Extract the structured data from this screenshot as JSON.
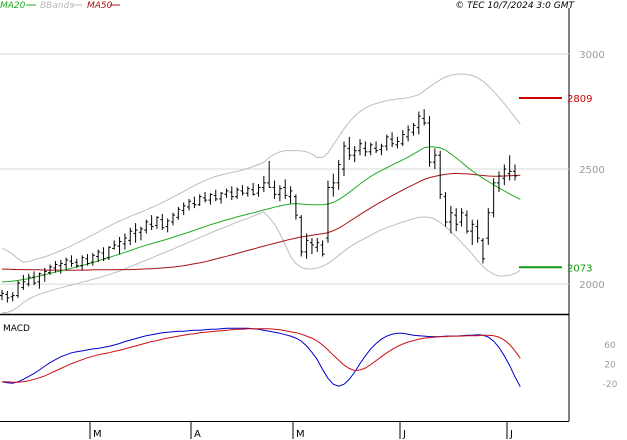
{
  "chart_data": [
    {
      "type": "ohlc",
      "legend": {
        "items": [
          {
            "label": "MA20",
            "color": "#22aa22"
          },
          {
            "label": "BBands",
            "color": "#b8b8b8"
          },
          {
            "label": "MA50",
            "color": "#aa1111"
          }
        ],
        "placement": "top-left"
      },
      "stamp": "© TEC 10/7/2024 3:0 GMT",
      "y_ticks": [
        "3000",
        "2500",
        "2000"
      ],
      "ylim": [
        1870,
        3200
      ],
      "x_ticks": [
        "M",
        "A",
        "M",
        "J",
        "J"
      ],
      "levels": [
        {
          "label": "2809",
          "value": 2809,
          "color": "#cc0000"
        },
        {
          "label": "2073",
          "value": 2073,
          "color": "#119911"
        }
      ],
      "price_ohlc": [
        [
          1950,
          1975,
          1930,
          1960
        ],
        [
          1955,
          1970,
          1920,
          1940
        ],
        [
          1945,
          1965,
          1925,
          1950
        ],
        [
          1950,
          2015,
          1940,
          2005
        ],
        [
          1985,
          2040,
          1975,
          2010
        ],
        [
          2000,
          2045,
          1990,
          2030
        ],
        [
          2030,
          2055,
          1995,
          2005
        ],
        [
          2010,
          2050,
          1980,
          2045
        ],
        [
          2040,
          2070,
          2010,
          2055
        ],
        [
          2050,
          2085,
          2040,
          2075
        ],
        [
          2070,
          2100,
          2050,
          2085
        ],
        [
          2080,
          2105,
          2045,
          2090
        ],
        [
          2085,
          2115,
          2060,
          2105
        ],
        [
          2100,
          2125,
          2075,
          2090
        ],
        [
          2095,
          2110,
          2070,
          2080
        ],
        [
          2080,
          2125,
          2060,
          2115
        ],
        [
          2110,
          2130,
          2080,
          2090
        ],
        [
          2095,
          2135,
          2080,
          2125
        ],
        [
          2120,
          2150,
          2095,
          2140
        ],
        [
          2135,
          2160,
          2100,
          2110
        ],
        [
          2115,
          2165,
          2105,
          2160
        ],
        [
          2155,
          2190,
          2150,
          2170
        ],
        [
          2165,
          2205,
          2130,
          2185
        ],
        [
          2175,
          2220,
          2150,
          2200
        ],
        [
          2190,
          2245,
          2170,
          2230
        ],
        [
          2220,
          2265,
          2180,
          2235
        ],
        [
          2225,
          2250,
          2190,
          2240
        ],
        [
          2235,
          2280,
          2220,
          2270
        ],
        [
          2260,
          2300,
          2235,
          2250
        ],
        [
          2255,
          2295,
          2240,
          2290
        ],
        [
          2280,
          2305,
          2235,
          2245
        ],
        [
          2250,
          2285,
          2225,
          2275
        ],
        [
          2270,
          2310,
          2255,
          2300
        ],
        [
          2290,
          2335,
          2280,
          2325
        ],
        [
          2320,
          2355,
          2300,
          2340
        ],
        [
          2335,
          2370,
          2320,
          2360
        ],
        [
          2350,
          2380,
          2330,
          2345
        ],
        [
          2345,
          2390,
          2340,
          2380
        ],
        [
          2375,
          2400,
          2355,
          2365
        ],
        [
          2365,
          2395,
          2345,
          2390
        ],
        [
          2385,
          2410,
          2360,
          2370
        ],
        [
          2370,
          2400,
          2350,
          2395
        ],
        [
          2390,
          2415,
          2375,
          2405
        ],
        [
          2400,
          2425,
          2365,
          2380
        ],
        [
          2380,
          2420,
          2370,
          2410
        ],
        [
          2405,
          2430,
          2385,
          2395
        ],
        [
          2395,
          2425,
          2380,
          2415
        ],
        [
          2410,
          2440,
          2385,
          2390
        ],
        [
          2395,
          2435,
          2380,
          2420
        ],
        [
          2420,
          2470,
          2400,
          2440
        ],
        [
          2440,
          2535,
          2420,
          2420
        ],
        [
          2420,
          2450,
          2370,
          2390
        ],
        [
          2390,
          2430,
          2360,
          2415
        ],
        [
          2420,
          2455,
          2370,
          2385
        ],
        [
          2380,
          2425,
          2350,
          2405
        ],
        [
          2380,
          2390,
          2280,
          2300
        ],
        [
          2290,
          2300,
          2120,
          2140
        ],
        [
          2140,
          2220,
          2110,
          2190
        ],
        [
          2180,
          2200,
          2130,
          2170
        ],
        [
          2160,
          2200,
          2140,
          2180
        ],
        [
          2170,
          2190,
          2120,
          2130
        ],
        [
          2200,
          2450,
          2180,
          2420
        ],
        [
          2420,
          2480,
          2380,
          2440
        ],
        [
          2440,
          2540,
          2410,
          2520
        ],
        [
          2500,
          2620,
          2470,
          2600
        ],
        [
          2590,
          2640,
          2540,
          2560
        ],
        [
          2560,
          2600,
          2530,
          2580
        ],
        [
          2580,
          2630,
          2560,
          2610
        ],
        [
          2590,
          2620,
          2555,
          2575
        ],
        [
          2575,
          2615,
          2560,
          2605
        ],
        [
          2590,
          2620,
          2570,
          2580
        ],
        [
          2585,
          2610,
          2560,
          2600
        ],
        [
          2600,
          2650,
          2580,
          2640
        ],
        [
          2630,
          2660,
          2595,
          2610
        ],
        [
          2605,
          2640,
          2590,
          2620
        ],
        [
          2610,
          2670,
          2600,
          2650
        ],
        [
          2640,
          2690,
          2620,
          2670
        ],
        [
          2660,
          2700,
          2645,
          2690
        ],
        [
          2680,
          2750,
          2650,
          2730
        ],
        [
          2720,
          2760,
          2690,
          2700
        ],
        [
          2700,
          2730,
          2510,
          2530
        ],
        [
          2530,
          2590,
          2500,
          2560
        ],
        [
          2560,
          2580,
          2370,
          2390
        ],
        [
          2380,
          2400,
          2250,
          2270
        ],
        [
          2270,
          2340,
          2220,
          2310
        ],
        [
          2300,
          2330,
          2230,
          2260
        ],
        [
          2270,
          2330,
          2250,
          2310
        ],
        [
          2300,
          2320,
          2220,
          2230
        ],
        [
          2230,
          2280,
          2170,
          2260
        ],
        [
          2250,
          2280,
          2180,
          2200
        ],
        [
          2190,
          2200,
          2090,
          2110
        ],
        [
          2200,
          2330,
          2170,
          2310
        ],
        [
          2310,
          2460,
          2290,
          2440
        ],
        [
          2440,
          2490,
          2400,
          2470
        ],
        [
          2460,
          2520,
          2430,
          2500
        ],
        [
          2480,
          2560,
          2450,
          2490
        ],
        [
          2490,
          2520,
          2450,
          2470
        ]
      ],
      "ma20": [
        2010,
        2011,
        2013,
        2016,
        2020,
        2024,
        2029,
        2035,
        2041,
        2047,
        2052,
        2058,
        2063,
        2069,
        2075,
        2081,
        2087,
        2094,
        2101,
        2108,
        2115,
        2123,
        2130,
        2138,
        2146,
        2154,
        2162,
        2169,
        2176,
        2183,
        2189,
        2196,
        2203,
        2211,
        2218,
        2226,
        2234,
        2242,
        2250,
        2258,
        2265,
        2272,
        2279,
        2285,
        2292,
        2298,
        2304,
        2310,
        2316,
        2322,
        2328,
        2334,
        2340,
        2344,
        2348,
        2350,
        2348,
        2346,
        2345,
        2345,
        2345,
        2348,
        2355,
        2367,
        2382,
        2399,
        2417,
        2435,
        2452,
        2468,
        2482,
        2494,
        2506,
        2518,
        2529,
        2540,
        2552,
        2565,
        2579,
        2593,
        2597,
        2596,
        2592,
        2582,
        2566,
        2548,
        2530,
        2510,
        2492,
        2476,
        2460,
        2446,
        2432,
        2418,
        2405,
        2392,
        2380,
        2368
      ],
      "bb_upper": [
        2155,
        2145,
        2130,
        2110,
        2095,
        2098,
        2105,
        2112,
        2118,
        2127,
        2136,
        2146,
        2156,
        2167,
        2179,
        2190,
        2202,
        2214,
        2226,
        2239,
        2251,
        2263,
        2274,
        2284,
        2294,
        2304,
        2313,
        2323,
        2333,
        2343,
        2354,
        2366,
        2378,
        2390,
        2403,
        2416,
        2428,
        2440,
        2450,
        2460,
        2468,
        2474,
        2480,
        2485,
        2490,
        2496,
        2503,
        2511,
        2520,
        2530,
        2550,
        2565,
        2575,
        2580,
        2580,
        2580,
        2579,
        2575,
        2565,
        2550,
        2550,
        2570,
        2605,
        2640,
        2675,
        2705,
        2730,
        2750,
        2765,
        2777,
        2785,
        2791,
        2797,
        2802,
        2805,
        2807,
        2810,
        2816,
        2823,
        2840,
        2857,
        2873,
        2888,
        2900,
        2908,
        2912,
        2913,
        2911,
        2906,
        2897,
        2882,
        2861,
        2838,
        2812,
        2784,
        2755,
        2725,
        2695
      ],
      "bb_lower": [
        1875,
        1877,
        1885,
        1900,
        1920,
        1935,
        1947,
        1956,
        1964,
        1971,
        1978,
        1984,
        1990,
        1996,
        2002,
        2008,
        2014,
        2021,
        2027,
        2034,
        2041,
        2049,
        2057,
        2066,
        2075,
        2085,
        2095,
        2104,
        2114,
        2124,
        2133,
        2143,
        2152,
        2162,
        2172,
        2182,
        2192,
        2202,
        2212,
        2222,
        2232,
        2241,
        2250,
        2260,
        2270,
        2278,
        2286,
        2295,
        2305,
        2313,
        2290,
        2260,
        2220,
        2170,
        2120,
        2090,
        2072,
        2066,
        2066,
        2070,
        2078,
        2090,
        2106,
        2125,
        2143,
        2160,
        2175,
        2188,
        2200,
        2212,
        2225,
        2236,
        2245,
        2254,
        2262,
        2270,
        2277,
        2284,
        2290,
        2292,
        2290,
        2282,
        2268,
        2250,
        2229,
        2205,
        2180,
        2156,
        2130,
        2102,
        2077,
        2057,
        2043,
        2035,
        2035,
        2038,
        2046,
        2060
      ],
      "ma50": [
        2065,
        2065,
        2064,
        2063,
        2063,
        2062,
        2062,
        2062,
        2061,
        2061,
        2061,
        2060,
        2060,
        2060,
        2061,
        2061,
        2061,
        2062,
        2062,
        2062,
        2062,
        2062,
        2063,
        2063,
        2063,
        2064,
        2065,
        2066,
        2067,
        2068,
        2070,
        2072,
        2074,
        2077,
        2080,
        2084,
        2088,
        2092,
        2097,
        2103,
        2109,
        2115,
        2121,
        2127,
        2133,
        2140,
        2146,
        2152,
        2159,
        2165,
        2171,
        2177,
        2183,
        2189,
        2195,
        2200,
        2205,
        2208,
        2212,
        2216,
        2219,
        2224,
        2232,
        2243,
        2257,
        2272,
        2287,
        2302,
        2317,
        2331,
        2345,
        2358,
        2371,
        2384,
        2397,
        2409,
        2421,
        2432,
        2444,
        2455,
        2463,
        2468,
        2473,
        2477,
        2480,
        2481,
        2480,
        2479,
        2477,
        2474,
        2472,
        2470,
        2469,
        2469,
        2470,
        2471,
        2472,
        2473
      ]
    },
    {
      "type": "line",
      "title": "MACD",
      "y_ticks": [
        "60",
        "20",
        "-20"
      ],
      "ylim": [
        -95,
        115
      ],
      "series": [
        {
          "name": "",
          "color": "#0000cc",
          "values": [
            -15,
            -17,
            -18,
            -15,
            -10,
            -4,
            2,
            9,
            17,
            24,
            30,
            36,
            40,
            44,
            46,
            48,
            50,
            52,
            53,
            55,
            57,
            60,
            63,
            67,
            70,
            73,
            76,
            79,
            81,
            83,
            85,
            86,
            87,
            88,
            88,
            89,
            90,
            90,
            91,
            92,
            92,
            93,
            94,
            94,
            94,
            94,
            94,
            93,
            92,
            90,
            88,
            86,
            84,
            81,
            78,
            74,
            68,
            58,
            45,
            30,
            10,
            -8,
            -20,
            -24,
            -20,
            -10,
            5,
            22,
            38,
            52,
            63,
            72,
            78,
            82,
            84,
            84,
            82,
            80,
            79,
            78,
            77,
            77,
            77,
            78,
            78,
            78,
            79,
            80,
            80,
            81,
            80,
            76,
            68,
            55,
            38,
            18,
            -5,
            -25
          ]
        },
        {
          "name": "",
          "color": "#cc1111",
          "values": [
            -15,
            -15,
            -16,
            -16,
            -15,
            -13,
            -10,
            -7,
            -3,
            2,
            7,
            12,
            17,
            22,
            26,
            30,
            34,
            37,
            40,
            42,
            44,
            47,
            49,
            52,
            55,
            58,
            61,
            64,
            67,
            69,
            72,
            74,
            76,
            78,
            80,
            82,
            83,
            85,
            86,
            87,
            88,
            89,
            90,
            91,
            92,
            92,
            93,
            93,
            93,
            93,
            93,
            92,
            91,
            89,
            87,
            85,
            82,
            78,
            74,
            68,
            60,
            50,
            39,
            29,
            19,
            12,
            8,
            9,
            13,
            20,
            28,
            36,
            44,
            51,
            57,
            62,
            66,
            69,
            72,
            74,
            75,
            76,
            77,
            77,
            78,
            78,
            78,
            79,
            79,
            79,
            80,
            80,
            79,
            76,
            70,
            61,
            48,
            33
          ]
        }
      ]
    }
  ]
}
